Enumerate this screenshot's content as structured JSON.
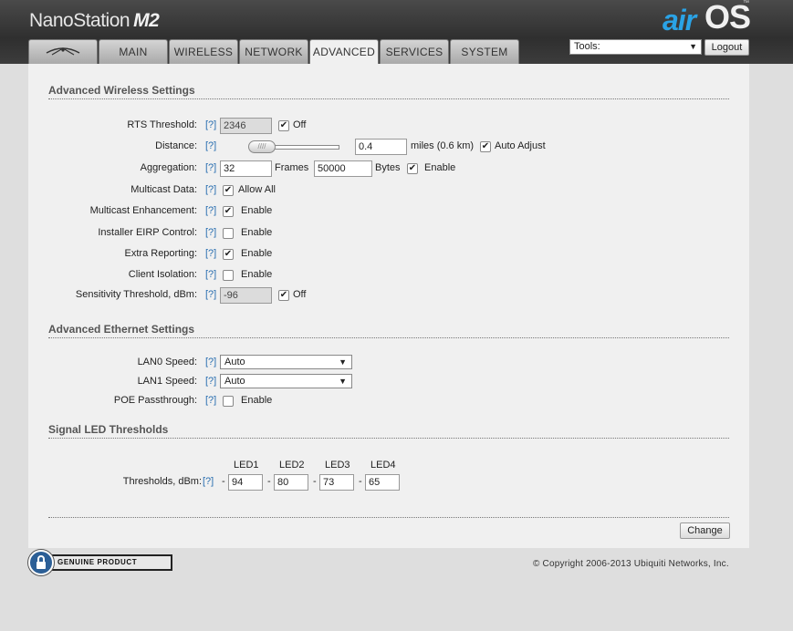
{
  "header": {
    "product_name": "NanoStation",
    "product_model": "M2",
    "logo_air": "air",
    "logo_os": "OS",
    "logo_tm": "™"
  },
  "tabs": [
    {
      "label": "",
      "icon": "ubiquiti-logo-icon"
    },
    {
      "label": "MAIN"
    },
    {
      "label": "WIRELESS"
    },
    {
      "label": "NETWORK"
    },
    {
      "label": "ADVANCED"
    },
    {
      "label": "SERVICES"
    },
    {
      "label": "SYSTEM"
    }
  ],
  "active_tab": "ADVANCED",
  "tools": {
    "selected": "Tools:",
    "arrow": "▼"
  },
  "logout_label": "Logout",
  "help_link": "[?]",
  "sections": {
    "wireless": "Advanced Wireless Settings",
    "ethernet": "Advanced Ethernet Settings",
    "led": "Signal LED Thresholds"
  },
  "wireless": {
    "rts_label": "RTS Threshold:",
    "rts_value": "2346",
    "rts_off_label": "Off",
    "rts_off_checked": true,
    "distance_label": "Distance:",
    "distance_value": "0.4",
    "distance_unit": "miles (0.6 km)",
    "distance_slider_fraction": 0.0,
    "auto_adjust_label": "Auto Adjust",
    "auto_adjust_checked": true,
    "aggregation_label": "Aggregation:",
    "aggregation_frames": "32",
    "frames_label": "Frames",
    "aggregation_bytes": "50000",
    "bytes_label": "Bytes",
    "aggregation_enable_label": "Enable",
    "aggregation_enable_checked": true,
    "multicast_label": "Multicast Data:",
    "multicast_value_label": "Allow All",
    "multicast_checked": true,
    "multicast_enh_label": "Multicast Enhancement:",
    "multicast_enh_value_label": "Enable",
    "multicast_enh_checked": true,
    "eirp_label": "Installer EIRP Control:",
    "eirp_value_label": "Enable",
    "eirp_checked": false,
    "extra_label": "Extra Reporting:",
    "extra_value_label": "Enable",
    "extra_checked": true,
    "isolation_label": "Client Isolation:",
    "isolation_value_label": "Enable",
    "isolation_checked": false,
    "sensitivity_label": "Sensitivity Threshold, dBm:",
    "sensitivity_value": "-96",
    "sensitivity_off_label": "Off",
    "sensitivity_off_checked": true
  },
  "ethernet": {
    "lan0_label": "LAN0 Speed:",
    "lan0_value": "Auto",
    "lan1_label": "LAN1 Speed:",
    "lan1_value": "Auto",
    "poe_label": "POE Passthrough:",
    "poe_value_label": "Enable",
    "poe_checked": false
  },
  "led": {
    "headers": [
      "LED1",
      "LED2",
      "LED3",
      "LED4"
    ],
    "label": "Thresholds, dBm:",
    "values": [
      "94",
      "80",
      "73",
      "65"
    ],
    "dash": "-"
  },
  "change_label": "Change",
  "genuine_text": "GENUINE   PRODUCT",
  "copyright": "© Copyright 2006-2013 Ubiquiti Networks, Inc."
}
